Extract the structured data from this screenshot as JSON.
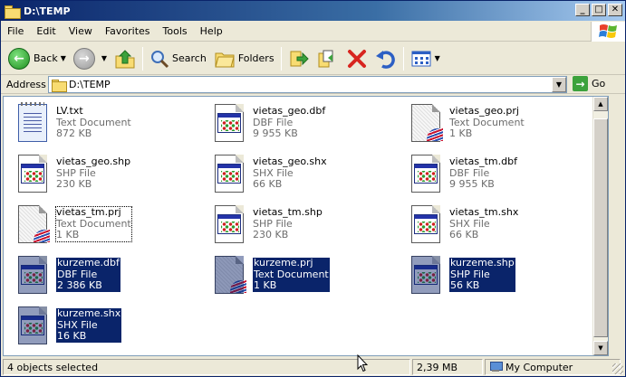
{
  "window": {
    "title": "D:\\TEMP"
  },
  "menu": [
    "File",
    "Edit",
    "View",
    "Favorites",
    "Tools",
    "Help"
  ],
  "toolbar": {
    "back_label": "Back",
    "search_label": "Search",
    "folders_label": "Folders"
  },
  "address": {
    "label": "Address",
    "value": "D:\\TEMP",
    "go_label": "Go"
  },
  "files": [
    {
      "name": "LV.txt",
      "type": "Text Document",
      "size": "872 KB",
      "icon": "notepad-icon",
      "selected": false
    },
    {
      "name": "vietas_geo.dbf",
      "type": "DBF File",
      "size": "9 955 KB",
      "icon": "application-icon",
      "selected": false
    },
    {
      "name": "vietas_geo.prj",
      "type": "Text Document",
      "size": "1 KB",
      "icon": "prj-icon",
      "selected": false
    },
    {
      "name": "vietas_geo.shp",
      "type": "SHP File",
      "size": "230 KB",
      "icon": "application-icon",
      "selected": false
    },
    {
      "name": "vietas_geo.shx",
      "type": "SHX File",
      "size": "66 KB",
      "icon": "application-icon",
      "selected": false
    },
    {
      "name": "vietas_tm.dbf",
      "type": "DBF File",
      "size": "9 955 KB",
      "icon": "application-icon",
      "selected": false
    },
    {
      "name": "vietas_tm.prj",
      "type": "Text Document",
      "size": "1 KB",
      "icon": "prj-icon",
      "selected": false,
      "focused": true
    },
    {
      "name": "vietas_tm.shp",
      "type": "SHP File",
      "size": "230 KB",
      "icon": "application-icon",
      "selected": false
    },
    {
      "name": "vietas_tm.shx",
      "type": "SHX File",
      "size": "66 KB",
      "icon": "application-icon",
      "selected": false
    },
    {
      "name": "kurzeme.dbf",
      "type": "DBF File",
      "size": "2 386 KB",
      "icon": "application-icon",
      "selected": true
    },
    {
      "name": "kurzeme.prj",
      "type": "Text Document",
      "size": "1 KB",
      "icon": "prj-icon",
      "selected": true
    },
    {
      "name": "kurzeme.shp",
      "type": "SHP File",
      "size": "56 KB",
      "icon": "application-icon",
      "selected": true
    },
    {
      "name": "kurzeme.shx",
      "type": "SHX File",
      "size": "16 KB",
      "icon": "application-icon",
      "selected": true
    }
  ],
  "status": {
    "objects": "4 objects selected",
    "size": "2,39 MB",
    "zone": "My Computer"
  },
  "colors": {
    "selection": "#0a246a",
    "title_start": "#0a246a",
    "chrome": "#ece9d8"
  }
}
